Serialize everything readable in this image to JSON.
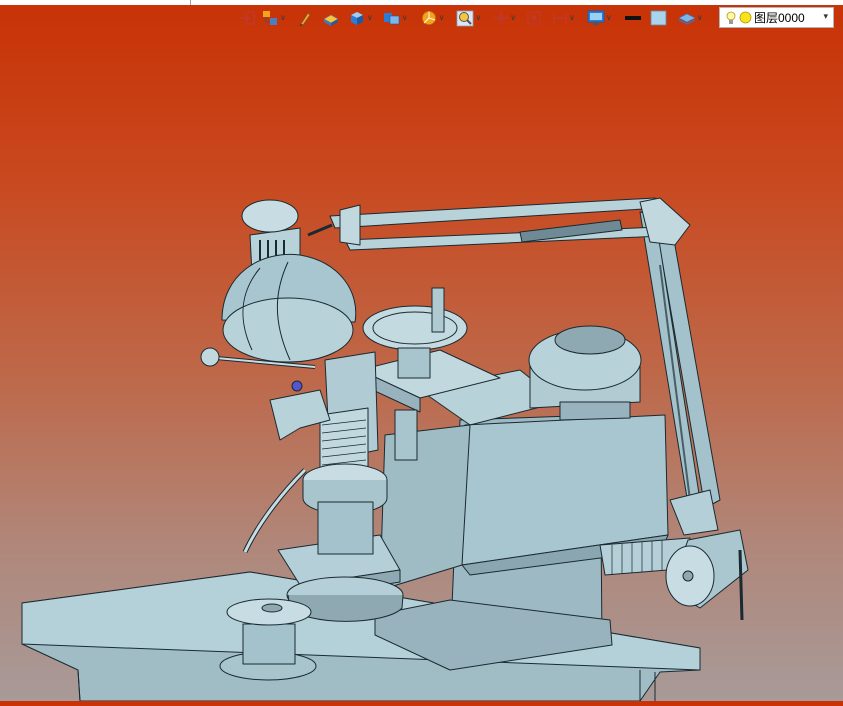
{
  "toolbar": {
    "buttons": [
      {
        "icon": "insert-component-icon",
        "has_dropdown": false
      },
      {
        "icon": "assembly-tree-icon",
        "has_dropdown": true
      },
      {
        "icon": "pencil-icon",
        "has_dropdown": false
      },
      {
        "icon": "solid-box-icon",
        "has_dropdown": false
      },
      {
        "icon": "cube-view-icon",
        "has_dropdown": true
      },
      {
        "icon": "display-mode-icon",
        "has_dropdown": true
      },
      {
        "icon": "section-view-icon",
        "has_dropdown": true
      },
      {
        "icon": "zoom-icon",
        "has_dropdown": true
      },
      {
        "icon": "move-part-icon",
        "has_dropdown": true
      },
      {
        "icon": "fit-view-icon",
        "has_dropdown": false
      },
      {
        "icon": "measure-icon",
        "has_dropdown": true
      },
      {
        "icon": "monitor-view-icon",
        "has_dropdown": true
      },
      {
        "icon": "line-color-icon",
        "has_dropdown": false
      },
      {
        "icon": "fill-color-icon",
        "has_dropdown": false
      },
      {
        "icon": "layers-icon",
        "has_dropdown": true
      }
    ],
    "colors": {
      "line": "#111111",
      "fill": "#a8d4ec",
      "accent": "#f5a31a"
    }
  },
  "layer": {
    "selected": "图层0000",
    "icons": [
      "lightbulb-icon",
      "sun-icon"
    ]
  },
  "viewport": {
    "background_top": "#c83206",
    "background_bottom": "#a89a98",
    "model_color": "#a3c2cc",
    "edge_color": "#1a2a30"
  }
}
